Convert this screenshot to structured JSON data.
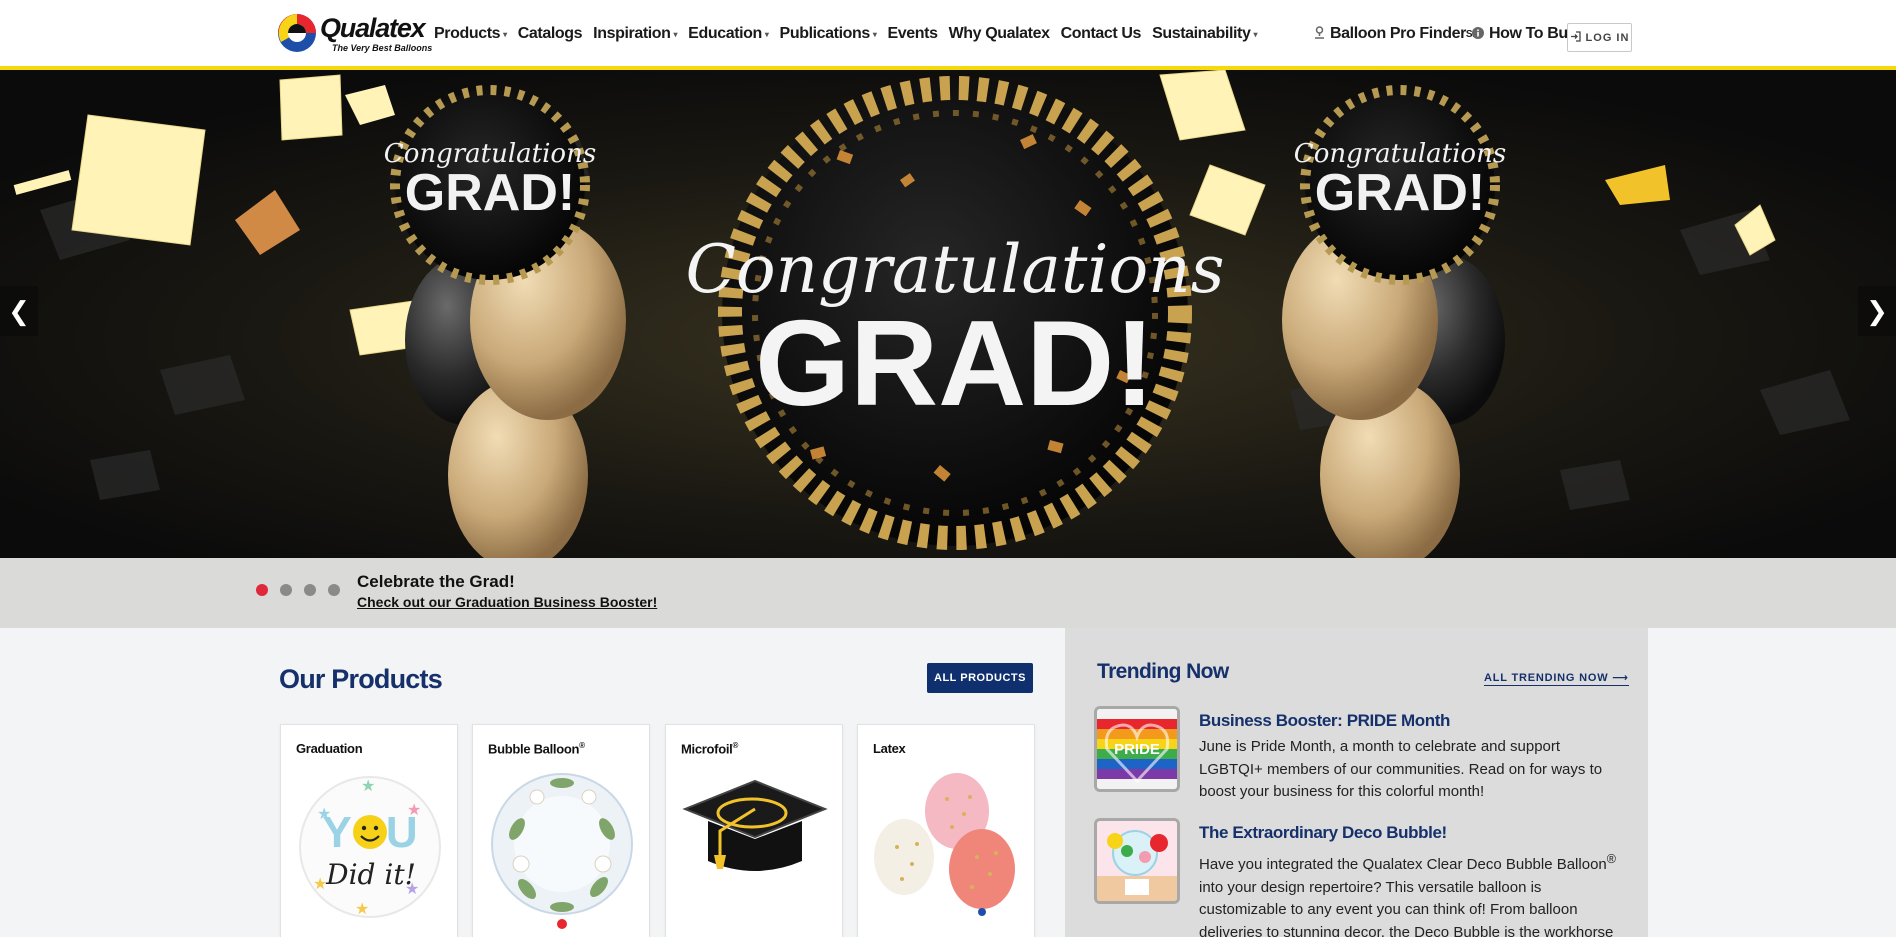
{
  "brand": {
    "name": "Qualatex",
    "tagline": "The Very Best Balloons"
  },
  "nav": {
    "items": [
      {
        "label": "Products",
        "has_dropdown": true
      },
      {
        "label": "Catalogs",
        "has_dropdown": false
      },
      {
        "label": "Inspiration",
        "has_dropdown": true
      },
      {
        "label": "Education",
        "has_dropdown": true
      },
      {
        "label": "Publications",
        "has_dropdown": true
      },
      {
        "label": "Events",
        "has_dropdown": false
      },
      {
        "label": "Why Qualatex",
        "has_dropdown": false
      },
      {
        "label": "Contact Us",
        "has_dropdown": false
      },
      {
        "label": "Sustainability",
        "has_dropdown": true
      }
    ],
    "caret": "▾"
  },
  "utility": {
    "pro_finder_label": "Balloon Pro Finder",
    "pro_finder_mark": "SM",
    "pro_finder_icon": "user-pin-icon",
    "how_to_buy_label": "How To Buy",
    "how_to_buy_icon": "info-icon",
    "login_label": "LOG IN",
    "login_icon": "sign-in-icon"
  },
  "hero": {
    "slide_text": {
      "main_top": "Congratulations",
      "main_bottom": "GRAD!",
      "side_top": "Congratulations",
      "side_bottom": "GRAD!"
    },
    "prev_arrow": "❮",
    "next_arrow": "❯",
    "slide_count": 4,
    "active_slide": 1,
    "caption_title": "Celebrate the Grad!",
    "caption_link": "Check out our Graduation Business Booster!"
  },
  "products": {
    "title": "Our Products",
    "all_button": "ALL PRODUCTS",
    "cards": [
      {
        "label": "Graduation",
        "mark": ""
      },
      {
        "label": "Bubble Balloon",
        "mark": "®"
      },
      {
        "label": "Microfoil",
        "mark": "®"
      },
      {
        "label": "Latex",
        "mark": ""
      }
    ],
    "graduation_art": {
      "letters_top": "YOU",
      "script": "Did it!"
    }
  },
  "trending": {
    "title": "Trending Now",
    "all_link": "ALL TRENDING NOW ⟶",
    "articles": [
      {
        "title": "Business Booster: PRIDE Month",
        "body": "June is Pride Month, a month to celebrate and support LGBTQI+ members of our communities. Read on for ways to boost your business for this colorful month!",
        "thumb_text": "PRIDE"
      },
      {
        "title": "The Extraordinary Deco Bubble!",
        "body_start": "Have you integrated the Qualatex Clear Deco Bubble Balloon",
        "body_mark": "®",
        "body_end": " into your design repertoire? This versatile balloon is customizable to any event you can think of! From balloon deliveries to stunning decor, the Deco Bubble is the workhorse"
      }
    ]
  },
  "colors": {
    "navy": "#15306b",
    "button_navy": "#102f6e",
    "header_accent_yellow": "#f5d90a",
    "active_dot_red": "#e0283b",
    "balloon_gold": "#c9a978"
  }
}
